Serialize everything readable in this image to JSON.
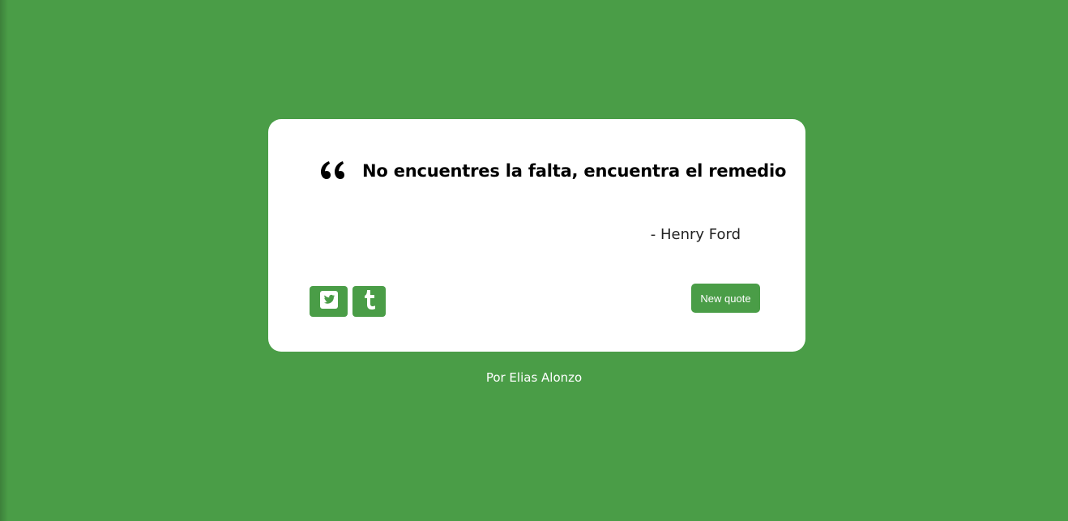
{
  "quote": {
    "text": "No encuentres la falta, encuentra el remedio",
    "author": "- Henry Ford",
    "icon": "quote-left-icon"
  },
  "actions": {
    "twitter_icon": "twitter-icon",
    "tumblr_icon": "tumblr-icon",
    "new_quote_label": "New quote"
  },
  "footer": {
    "credit": "Por Elias Alonzo"
  },
  "colors": {
    "background": "#4a9d47",
    "card": "#ffffff",
    "accent": "#4a9d47"
  }
}
